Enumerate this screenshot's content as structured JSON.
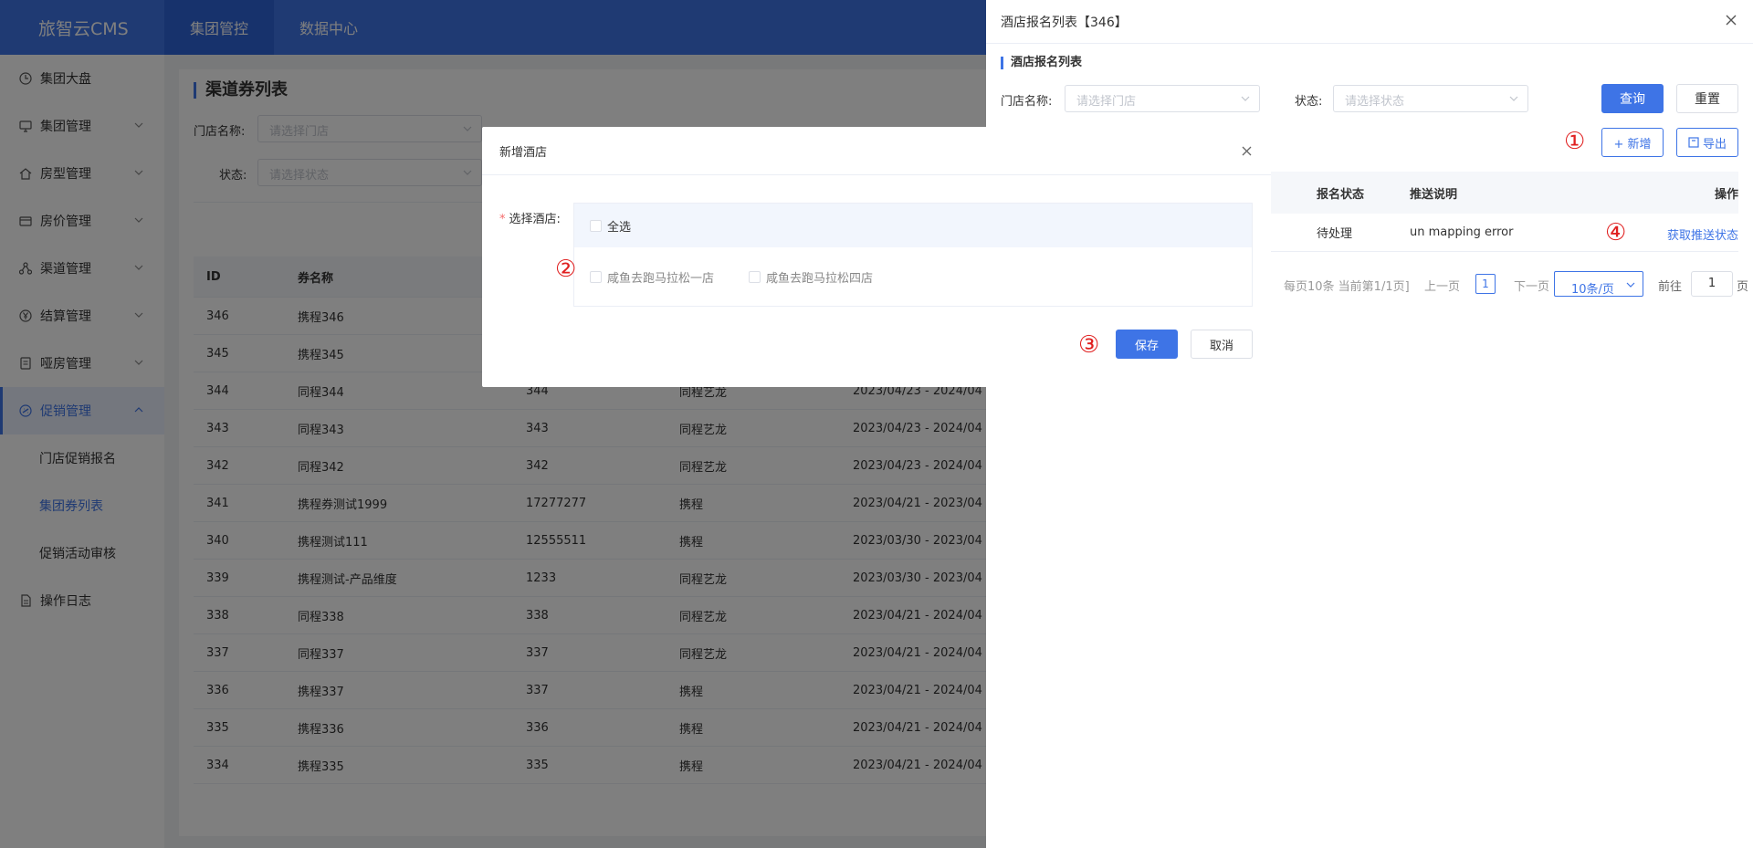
{
  "app": {
    "logo": "旅智云CMS"
  },
  "topnav": [
    {
      "label": "集团管控",
      "active": true
    },
    {
      "label": "数据中心",
      "active": false
    }
  ],
  "sidebar": {
    "items": [
      {
        "label": "集团大盘",
        "icon": "clock-icon",
        "has_children": false
      },
      {
        "label": "集团管理",
        "icon": "monitor-icon",
        "has_children": true
      },
      {
        "label": "房型管理",
        "icon": "home-icon",
        "has_children": true
      },
      {
        "label": "房价管理",
        "icon": "card-icon",
        "has_children": true
      },
      {
        "label": "渠道管理",
        "icon": "share-icon",
        "has_children": true
      },
      {
        "label": "结算管理",
        "icon": "yen-icon",
        "has_children": true
      },
      {
        "label": "哑房管理",
        "icon": "document-icon",
        "has_children": true
      },
      {
        "label": "促销管理",
        "icon": "promotion-icon",
        "has_children": true,
        "active": true
      }
    ],
    "sub_items": [
      {
        "label": "门店促销报名",
        "active": false
      },
      {
        "label": "集团券列表",
        "active": true
      },
      {
        "label": "促销活动审核",
        "active": false
      }
    ],
    "footer_item": {
      "label": "操作日志",
      "icon": "log-icon"
    }
  },
  "main": {
    "title": "渠道券列表",
    "filters": {
      "store_label": "门店名称:",
      "store_placeholder": "请选择门店",
      "status_label": "状态:",
      "status_placeholder": "请选择状态"
    },
    "table": {
      "headers": [
        "ID",
        "券名称",
        "",
        "",
        ""
      ],
      "rows": [
        [
          "346",
          "携程346",
          "",
          "",
          ""
        ],
        [
          "345",
          "携程345",
          "",
          "",
          ""
        ],
        [
          "344",
          "同程344",
          "344",
          "同程艺龙",
          "2023/04/23 - 2024/04"
        ],
        [
          "343",
          "同程343",
          "343",
          "同程艺龙",
          "2023/04/23 - 2024/04"
        ],
        [
          "342",
          "同程342",
          "342",
          "同程艺龙",
          "2023/04/23 - 2024/04"
        ],
        [
          "341",
          "携程券测试1999",
          "17277277",
          "携程",
          "2023/04/21 - 2023/04"
        ],
        [
          "340",
          "携程测试111",
          "12555511",
          "携程",
          "2023/03/30 - 2023/04"
        ],
        [
          "339",
          "携程测试-产品维度",
          "1233",
          "同程艺龙",
          "2023/03/30 - 2023/04"
        ],
        [
          "338",
          "同程338",
          "338",
          "同程艺龙",
          "2023/04/21 - 2024/04"
        ],
        [
          "337",
          "同程337",
          "337",
          "同程艺龙",
          "2023/04/21 - 2024/04"
        ],
        [
          "336",
          "携程337",
          "337",
          "携程",
          "2023/04/21 - 2024/04"
        ],
        [
          "335",
          "携程336",
          "336",
          "携程",
          "2023/04/21 - 2024/04"
        ],
        [
          "334",
          "携程335",
          "335",
          "携程",
          "2023/04/21 - 2024/04"
        ]
      ]
    }
  },
  "drawer": {
    "title": "酒店报名列表【346】",
    "section_title": "酒店报名列表",
    "store_label": "门店名称:",
    "store_placeholder": "请选择门店",
    "status_label": "状态:",
    "status_placeholder": "请选择状态",
    "query_button": "查询",
    "reset_button": "重置",
    "add_button": "+ 新增",
    "export_button": "导出",
    "table": {
      "headers": [
        "报名状态",
        "推送说明",
        "操作"
      ],
      "row": {
        "status": "待处理",
        "note": "un mapping error",
        "action": "获取推送状态"
      }
    },
    "pager": {
      "summary": "每页10条 当前第1/1页]",
      "prev": "上一页",
      "page": "1",
      "next": "下一页",
      "size": "10条/页",
      "goto": "前往",
      "goto_value": "1",
      "page_unit": "页"
    },
    "callouts": [
      "①",
      "④"
    ]
  },
  "modal": {
    "title": "新增酒店",
    "field_label": "选择酒店:",
    "select_all": "全选",
    "hotels": [
      "咸鱼去跑马拉松一店",
      "咸鱼去跑马拉松四店"
    ],
    "save_button": "保存",
    "cancel_button": "取消",
    "callouts": [
      "②",
      "③"
    ]
  },
  "colors": {
    "primary": "#3e74e6",
    "callout": "#e02020"
  }
}
